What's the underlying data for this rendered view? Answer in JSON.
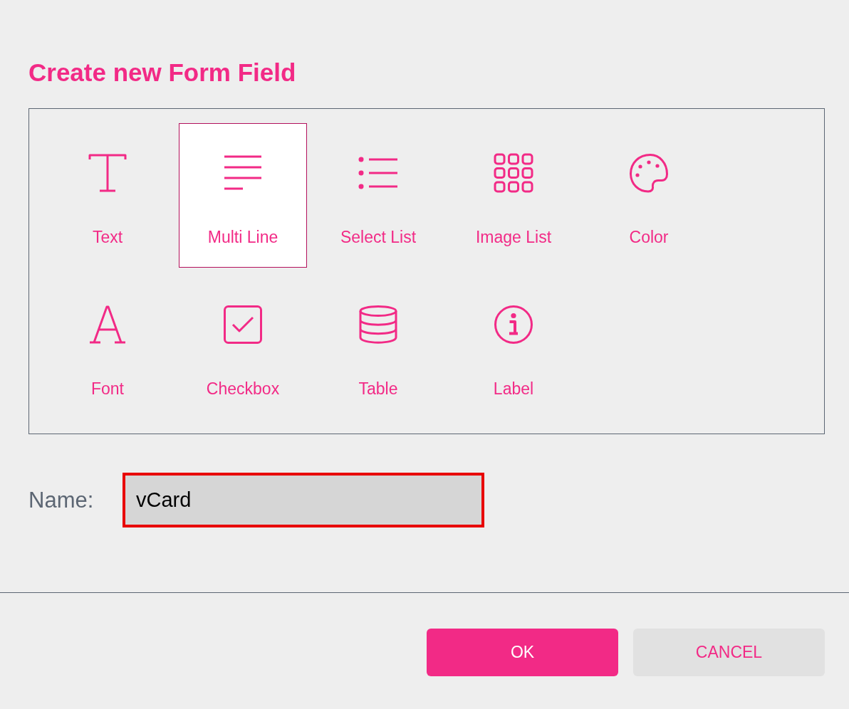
{
  "dialog": {
    "title": "Create new Form Field"
  },
  "field_types": [
    {
      "kind": "text",
      "label": "Text",
      "selected": false
    },
    {
      "kind": "multiline",
      "label": "Multi Line",
      "selected": true
    },
    {
      "kind": "select",
      "label": "Select List",
      "selected": false
    },
    {
      "kind": "imagelist",
      "label": "Image List",
      "selected": false
    },
    {
      "kind": "color",
      "label": "Color",
      "selected": false
    },
    {
      "kind": "font",
      "label": "Font",
      "selected": false
    },
    {
      "kind": "checkbox",
      "label": "Checkbox",
      "selected": false
    },
    {
      "kind": "table",
      "label": "Table",
      "selected": false
    },
    {
      "kind": "label",
      "label": "Label",
      "selected": false
    }
  ],
  "name_field": {
    "label": "Name:",
    "value": "vCard"
  },
  "buttons": [
    {
      "kind": "primary",
      "label": "OK"
    },
    {
      "kind": "secondary",
      "label": "CANCEL"
    }
  ]
}
